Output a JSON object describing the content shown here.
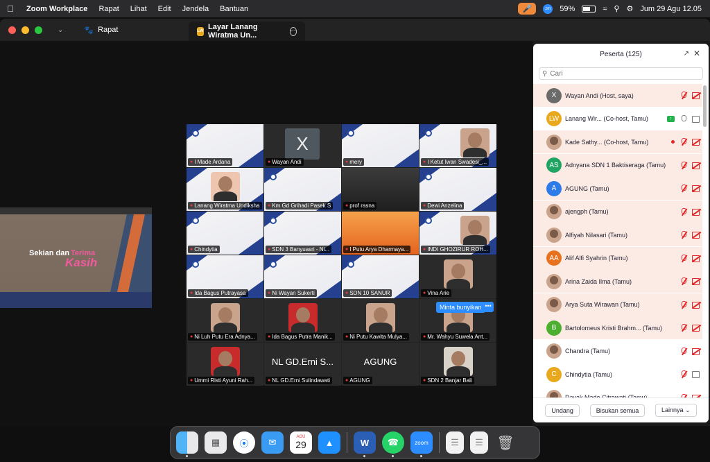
{
  "menubar": {
    "app_name": "Zoom Workplace",
    "menus": [
      "Rapat",
      "Lihat",
      "Edit",
      "Jendela",
      "Bantuan"
    ],
    "zoom_icon_label": "zm",
    "battery": "59%",
    "datetime": "Jum 29 Agu  12.05"
  },
  "window": {
    "tab1_label": "Rapat",
    "tab2_label": "Layar Lanang Wiratma Un...",
    "tab2_badge": "LW"
  },
  "shared_screen": {
    "line1": "Sekian dan",
    "line2": "Terima",
    "line3": "Kasih"
  },
  "video_tiles": [
    {
      "name": "I Made Ardana",
      "style": "slide"
    },
    {
      "name": "Wayan Andi",
      "style": "avatar",
      "avatar_text": "X"
    },
    {
      "name": "mery",
      "style": "slide"
    },
    {
      "name": "I Ketut Iwan Swadesi_...",
      "style": "slide-person"
    },
    {
      "name": "Lanang Wiratma Undiksha",
      "style": "person",
      "active": true
    },
    {
      "name": "Km Gd Grihadi Pasek S",
      "style": "slide"
    },
    {
      "name": "prof rasna",
      "style": "dark"
    },
    {
      "name": "Dewi Anzelina",
      "style": "slide"
    },
    {
      "name": "Chindytia",
      "style": "slide"
    },
    {
      "name": "SDN 3 Banyuasri - Ni...",
      "style": "slide"
    },
    {
      "name": "I Putu Arya Dharmaya...",
      "style": "orange"
    },
    {
      "name": "INDI GHOZIRUR ROH...",
      "style": "slide-person"
    },
    {
      "name": "Ida Bagus Putrayasa",
      "style": "slide"
    },
    {
      "name": "Ni Wayan Sukerti",
      "style": "slide"
    },
    {
      "name": "SDN 10 SANUR",
      "style": "slide"
    },
    {
      "name": "Vina Arie",
      "style": "person-dark"
    },
    {
      "name": "Ni Luh Putu Era Adnya...",
      "style": "person-dark"
    },
    {
      "name": "Ida Bagus Putra Manik...",
      "style": "person-red"
    },
    {
      "name": "Ni Putu Kawita Mulya...",
      "style": "person-dark"
    },
    {
      "name": "Mr. Wahyu Suwela Ant...",
      "style": "person-dark"
    },
    {
      "name": "Ummi Risti Ayuni Rah...",
      "style": "person-red"
    },
    {
      "name": "NL GD.Erni Sulindawati",
      "style": "text",
      "big_text": "NL GD.Erni S..."
    },
    {
      "name": "AGUNG",
      "style": "text",
      "big_text": "AGUNG"
    },
    {
      "name": "SDN 2 Banjar Bali",
      "style": "person-light"
    }
  ],
  "unmute_prompt": {
    "label": "Minta bunyikan",
    "more": "•••"
  },
  "participants": {
    "title": "Peserta (125)",
    "search_placeholder": "Cari",
    "rows": [
      {
        "name": "Wayan Andi (Host, saya)",
        "avatar": "X",
        "color": "#6b6b6b",
        "mic": "off",
        "cam": "off",
        "hl": true
      },
      {
        "name": "Lanang Wir...  (Co-host, Tamu)",
        "avatar": "LW",
        "color": "#e9a91f",
        "mic": "on",
        "cam": "on",
        "share": true,
        "hl": false
      },
      {
        "name": "Kade Sathy...  (Co-host, Tamu)",
        "avatar": "",
        "color": "photo",
        "mic": "off",
        "cam": "off",
        "rec": true,
        "hl": true
      },
      {
        "name": "Adnyana SDN 1 Baktiseraga  (Tamu)",
        "avatar": "AS",
        "color": "#1fa463",
        "mic": "off",
        "cam": "off",
        "hl": true
      },
      {
        "name": "AGUNG (Tamu)",
        "avatar": "A",
        "color": "#2d7be8",
        "mic": "off",
        "cam": "off",
        "hl": true
      },
      {
        "name": "ajengph (Tamu)",
        "avatar": "",
        "color": "photo",
        "mic": "off",
        "cam": "off",
        "hl": true
      },
      {
        "name": "Alfiyah Nilasari (Tamu)",
        "avatar": "",
        "color": "photo",
        "mic": "off",
        "cam": "off",
        "hl": true
      },
      {
        "name": "Alif Alfi Syahrin (Tamu)",
        "avatar": "AA",
        "color": "#e8711e",
        "mic": "off",
        "cam": "off",
        "hl": true
      },
      {
        "name": "Arina Zaida Ilma (Tamu)",
        "avatar": "",
        "color": "photo",
        "mic": "off",
        "cam": "off",
        "hl": true
      },
      {
        "name": "Arya Suta Wirawan (Tamu)",
        "avatar": "",
        "color": "photo",
        "mic": "off",
        "cam": "off",
        "hl": true
      },
      {
        "name": "Bartolomeus Kristi Brahm...  (Tamu)",
        "avatar": "B",
        "color": "#4caf2f",
        "mic": "off",
        "cam": "off",
        "hl": true
      },
      {
        "name": "Chandra (Tamu)",
        "avatar": "",
        "color": "photo",
        "mic": "off",
        "cam": "off",
        "hl": false
      },
      {
        "name": "Chindytia (Tamu)",
        "avatar": "C",
        "color": "#e9a91f",
        "mic": "off",
        "cam": "on",
        "hl": false
      },
      {
        "name": "Dayak Made Citrawati (Tamu)",
        "avatar": "",
        "color": "photo",
        "mic": "off",
        "cam": "off",
        "hl": false
      }
    ],
    "footer": {
      "invite": "Undang",
      "mute_all": "Bisukan semua",
      "more": "Lainnya"
    }
  },
  "dock": {
    "calendar_month": "AGU",
    "calendar_day": "29",
    "word_label": "W",
    "zoom_label": "zoom"
  }
}
